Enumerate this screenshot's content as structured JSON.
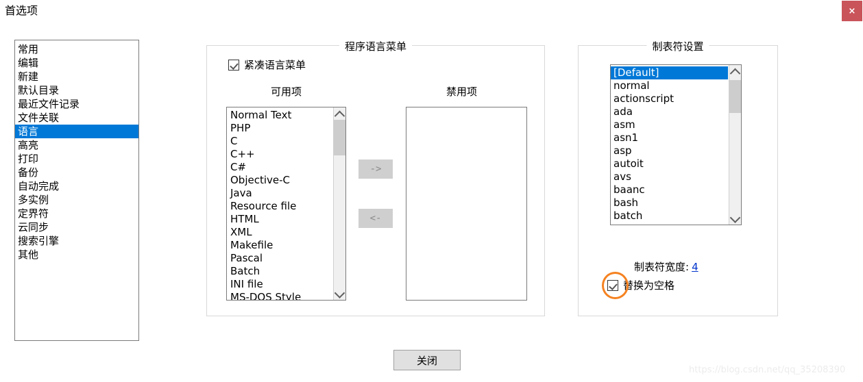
{
  "window": {
    "title": "首选项",
    "close_icon": "×"
  },
  "sidebar": {
    "items": [
      {
        "label": "常用",
        "selected": false
      },
      {
        "label": "编辑",
        "selected": false
      },
      {
        "label": "新建",
        "selected": false
      },
      {
        "label": "默认目录",
        "selected": false
      },
      {
        "label": "最近文件记录",
        "selected": false
      },
      {
        "label": "文件关联",
        "selected": false
      },
      {
        "label": "语言",
        "selected": true
      },
      {
        "label": "高亮",
        "selected": false
      },
      {
        "label": "打印",
        "selected": false
      },
      {
        "label": "备份",
        "selected": false
      },
      {
        "label": "自动完成",
        "selected": false
      },
      {
        "label": "多实例",
        "selected": false
      },
      {
        "label": "定界符",
        "selected": false
      },
      {
        "label": "云同步",
        "selected": false
      },
      {
        "label": "搜索引擎",
        "selected": false
      },
      {
        "label": "其他",
        "selected": false
      }
    ]
  },
  "language_group": {
    "title": "程序语言菜单",
    "compact_menu": {
      "label": "紧凑语言菜单",
      "checked": true
    },
    "available_caption": "可用项",
    "disabled_caption": "禁用项",
    "available_items": [
      "Normal Text",
      "PHP",
      "C",
      "C++",
      "C#",
      "Objective-C",
      "Java",
      "Resource file",
      "HTML",
      "XML",
      "Makefile",
      "Pascal",
      "Batch",
      "INI file",
      "MS-DOS Style"
    ],
    "disabled_items": [],
    "move_right_label": "->",
    "move_left_label": "<-"
  },
  "tab_group": {
    "title": "制表符设置",
    "items": [
      {
        "label": "[Default]",
        "selected": true
      },
      {
        "label": "normal",
        "selected": false
      },
      {
        "label": "actionscript",
        "selected": false
      },
      {
        "label": "ada",
        "selected": false
      },
      {
        "label": "asm",
        "selected": false
      },
      {
        "label": "asn1",
        "selected": false
      },
      {
        "label": "asp",
        "selected": false
      },
      {
        "label": "autoit",
        "selected": false
      },
      {
        "label": "avs",
        "selected": false
      },
      {
        "label": "baanc",
        "selected": false
      },
      {
        "label": "bash",
        "selected": false
      },
      {
        "label": "batch",
        "selected": false
      }
    ],
    "tab_width_label": "制表符宽度:",
    "tab_width_value": "4",
    "replace_space": {
      "label": "替换为空格",
      "checked": true
    }
  },
  "footer": {
    "close_label": "关闭"
  },
  "watermark": {
    "text": "https://blog.csdn.net/qq_35208390"
  },
  "colors": {
    "selection": "#0078d7",
    "close_button": "#c9545a",
    "highlight_annotation": "#f58220",
    "link": "#0033cc"
  }
}
